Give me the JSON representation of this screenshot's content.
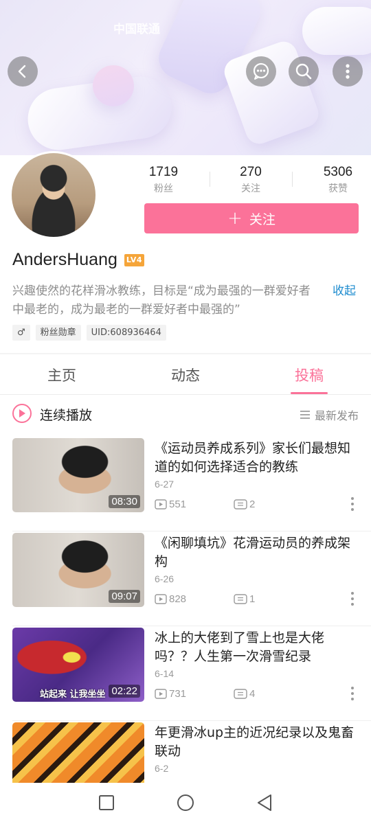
{
  "status_bar": {
    "carrier": "中国联通"
  },
  "banner": {
    "back_icon": "chevron-left-icon",
    "message_icon": "chat-bubble-icon",
    "search_icon": "search-icon",
    "more_icon": "more-vertical-icon"
  },
  "profile": {
    "stats": [
      {
        "value": "1719",
        "label": "粉丝"
      },
      {
        "value": "270",
        "label": "关注"
      },
      {
        "value": "5306",
        "label": "获赞"
      }
    ],
    "follow_button": "关注",
    "username": "AndersHuang",
    "level": "LV4",
    "bio": "兴趣使然的花样滑冰教练，目标是“成为最强的一群爱好者中最老的，成为最老的一群爱好者中最强的”",
    "collapse_label": "收起",
    "tags": {
      "gender": "♂",
      "fan_medal": "粉丝勋章",
      "uid": "UID:608936464"
    }
  },
  "tabs": [
    {
      "label": "主页"
    },
    {
      "label": "动态"
    },
    {
      "label": "投稿",
      "active": true
    }
  ],
  "playlist": {
    "label": "连续播放",
    "sort_label": "最新发布"
  },
  "videos": [
    {
      "title": "《运动员养成系列》家长们最想知道的如何选择适合的教练",
      "date": "6-27",
      "duration": "08:30",
      "views": "551",
      "comments": "2"
    },
    {
      "title": "《闲聊填坑》花滑运动员的养成架构",
      "date": "6-26",
      "duration": "09:07",
      "views": "828",
      "comments": "1"
    },
    {
      "title": "冰上的大佬到了雪上也是大佬吗？？人生第一次滑雪纪录",
      "date": "6-14",
      "duration": "02:22",
      "views": "731",
      "comments": "4",
      "subtitle": "站起来 让我坐坐"
    },
    {
      "title": "年更滑冰up主的近况纪录以及鬼畜联动",
      "date": "6-2",
      "duration": "",
      "views": "",
      "comments": ""
    }
  ],
  "colors": {
    "accent": "#fb7299",
    "link": "#1e8ccf",
    "level_badge": "#f5a53a"
  },
  "nav": {
    "recent_icon": "square-icon",
    "home_icon": "circle-icon",
    "back_icon": "triangle-back-icon"
  }
}
